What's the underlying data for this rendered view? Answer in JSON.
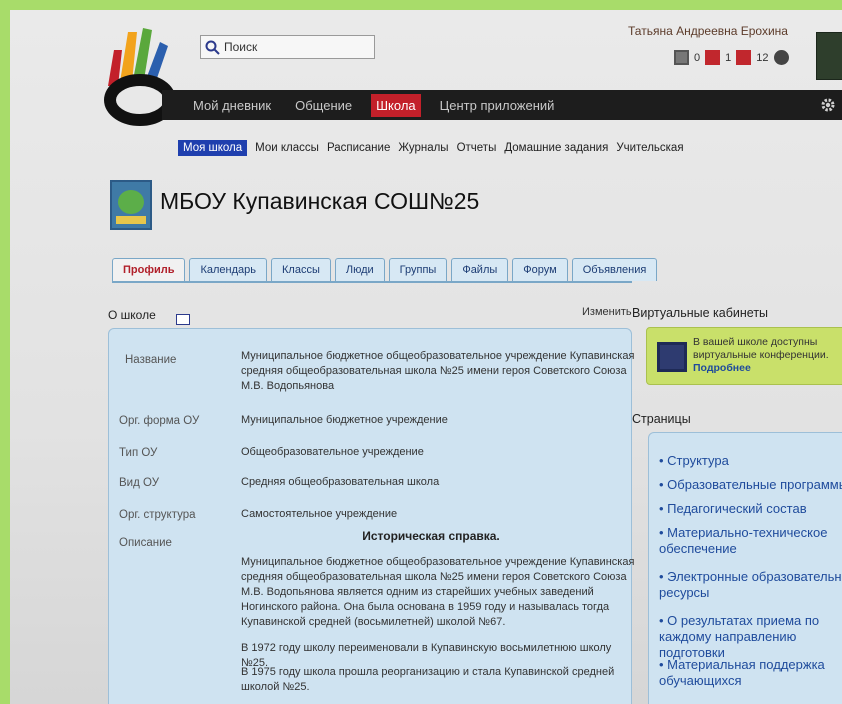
{
  "header": {
    "search_placeholder": "Поиск",
    "user_name": "Татьяна Андреевна Ерохина",
    "counters": [
      {
        "icon": "mail-icon",
        "value": "0"
      },
      {
        "icon": "alert-icon",
        "value": "1"
      },
      {
        "icon": "message-icon",
        "value": "12"
      }
    ]
  },
  "topnav": [
    "Мой дневник",
    "Общение",
    "Школа",
    "Центр приложений"
  ],
  "subnav": [
    "Моя школа",
    "Мои классы",
    "Расписание",
    "Журналы",
    "Отчеты",
    "Домашние задания",
    "Учительская"
  ],
  "school_title": "МБОУ Купавинская СОШ№25",
  "tabs": [
    "Профиль",
    "Календарь",
    "Классы",
    "Люди",
    "Группы",
    "Файлы",
    "Форум",
    "Объявления"
  ],
  "about": {
    "label": "О школе",
    "edit": "Изменить",
    "rows": [
      {
        "label": "Название",
        "value": "Муниципальное бюджетное общеобразовательное учреждение Купавинская средняя общеобразовательная школа №25 имени героя Советского Союза М.В. Водопьянова"
      },
      {
        "label": "Орг. форма ОУ",
        "value": "Муниципальное бюджетное учреждение"
      },
      {
        "label": "Тип ОУ",
        "value": "Общеобразовательное учреждение"
      },
      {
        "label": "Вид ОУ",
        "value": "Средняя общеобразовательная школа"
      },
      {
        "label": "Орг. структура",
        "value": "Самостоятельное учреждение"
      },
      {
        "label": "Описание",
        "value": ""
      }
    ],
    "description_title": "Историческая справка.",
    "description": [
      "Муниципальное бюджетное общеобразовательное учреждение Купавинская средняя общеобразовательная школа №25 имени героя Советского Союза М.В. Водопьянова является одним из старейших учебных заведений Ногинского района. Она была основана в 1959 году и называлась тогда Купавинской средней (восьмилетней) школой №67.",
      "В 1972 году школу переименовали в Купавинскую восьмилетнюю школу №25.",
      "В 1975 году школа прошла реорганизацию и стала Купавинской средней школой №25."
    ]
  },
  "right": {
    "virtual_title": "Виртуальные кабинеты",
    "virtual_text": "В вашей школе доступны виртуальные конференции.",
    "virtual_link": "Подробнее",
    "pages_title": "Страницы",
    "pages": [
      "Структура",
      "Образовательные программы",
      "Педагогический состав",
      "Материально-техническое обеспечение",
      "Электронные образовательные ресурсы",
      "О результатах приема по каждому направлению подготовки",
      "Материальная поддержка обучающихся"
    ]
  }
}
